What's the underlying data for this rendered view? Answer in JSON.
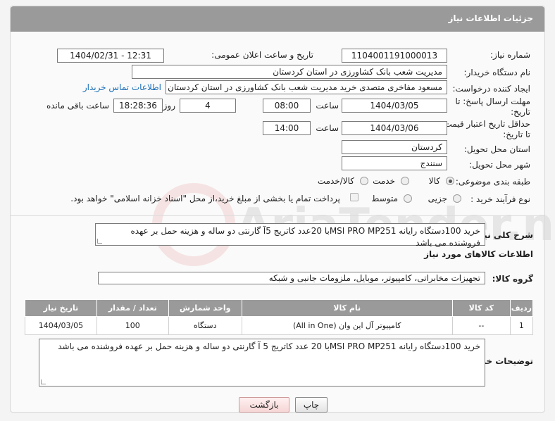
{
  "header": {
    "title": "جزئیات اطلاعات نیاز"
  },
  "fields": {
    "need_number": {
      "label": "شماره نیاز:",
      "value": "1104001191000013"
    },
    "announce_datetime": {
      "label": "تاریخ و ساعت اعلان عمومی:",
      "value": "1404/02/31 - 12:31"
    },
    "buyer_org": {
      "label": "نام دستگاه خریدار:",
      "value": "مدیریت شعب بانک کشاورزی در استان کردستان"
    },
    "requester": {
      "label": "ایجاد کننده درخواست:",
      "value": "مسعود  مفاخری  متصدی خرید  مدیریت شعب بانک کشاورزی در استان کردستان",
      "contact_link": "اطلاعات تماس خریدار"
    },
    "reply_deadline": {
      "label_line1": "مهلت ارسال پاسخ: تا",
      "label_line2": "تاریخ:",
      "date": "1404/03/05",
      "time_label": "ساعت",
      "time": "08:00",
      "days": "4",
      "days_label": "روز و",
      "remaining": "18:28:36",
      "remaining_label": "ساعت باقی مانده"
    },
    "price_validity": {
      "label_line1": "حداقل تاریخ اعتبار قیمت:",
      "label_line2": "تا تاریخ:",
      "date": "1404/03/06",
      "time_label": "ساعت",
      "time": "14:00"
    },
    "province": {
      "label": "استان محل تحویل:",
      "value": "کردستان"
    },
    "city": {
      "label": "شهر محل تحویل:",
      "value": "سنندج"
    },
    "category": {
      "label": "طبقه بندی موضوعی:",
      "options": [
        "کالا",
        "خدمت",
        "کالا/خدمت"
      ],
      "selected": "کالا"
    },
    "process_type": {
      "label": "نوع فرآیند خرید :",
      "options": [
        "جزیی",
        "متوسط"
      ],
      "selected": "",
      "payment_note": "پرداخت تمام یا بخشی از مبلغ خرید،از محل \"اسناد خزانه اسلامی\" خواهد بود."
    }
  },
  "general_description": {
    "label": "شرح کلی نیاز:",
    "value": "خرید 100دستگاه رایانه MSI PRO MP251با 20عدد کاتریج 5آ گارنتی دو ساله و هزینه حمل بر عهده فروشنده می باشد"
  },
  "items_section": {
    "title": "اطلاعات کالاهای مورد نیاز",
    "group_label": "گروه کالا:",
    "group_value": "تجهیزات مخابراتی، کامپیوتر، موبایل، ملزومات جانبی و شبکه",
    "table": {
      "headers": [
        "ردیف",
        "کد کالا",
        "نام کالا",
        "واحد شمارش",
        "تعداد / مقدار",
        "تاریخ نیاز"
      ],
      "rows": [
        [
          "1",
          "--",
          "کامپیوتر آل این وان (All in One)",
          "دستگاه",
          "100",
          "1404/03/05"
        ]
      ]
    }
  },
  "buyer_notes": {
    "label": "توضیحات خریدار:",
    "value": "خرید 100دستگاه رایانه MSI PRO MP251با  20 عدد کاتریج 5 آ گارنتی دو ساله و هزینه حمل بر عهده فروشنده می باشد"
  },
  "buttons": {
    "print": "چاپ",
    "back": "بازگشت"
  },
  "watermark": {
    "text": "AriaTender.neT"
  },
  "colors": {
    "header_bg": "#9a9a9a",
    "link": "#1b6fb8",
    "watermark": "#e07070"
  }
}
